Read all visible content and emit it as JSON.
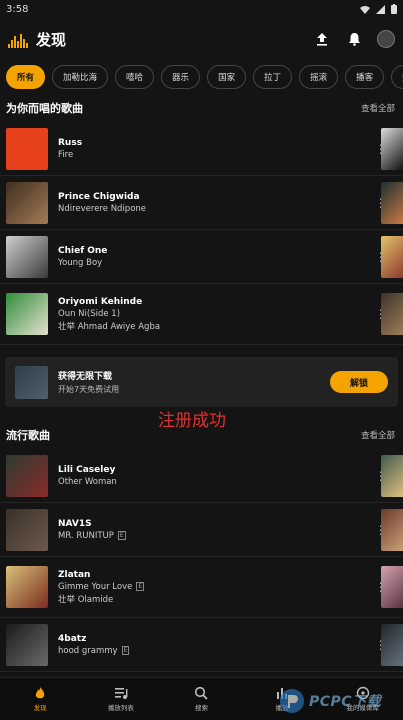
{
  "status": {
    "time": "3:58"
  },
  "header": {
    "title": "发现"
  },
  "chips": [
    "所有",
    "加勒比海",
    "嘻哈",
    "器乐",
    "国家",
    "拉丁",
    "摇滚",
    "播客",
    "旁遇"
  ],
  "section1": {
    "title": "为你而唱的歌曲",
    "see_all": "查看全部"
  },
  "songs1": [
    {
      "name": "Russ",
      "sub": "Fire",
      "sub2": "",
      "colors": [
        "#e6411c",
        "#e6411c"
      ],
      "peek": [
        "#ddd",
        "#111"
      ]
    },
    {
      "name": "Prince Chigwida",
      "sub": "Ndireverere Ndipone",
      "sub2": "",
      "colors": [
        "#3f2e22",
        "#a47b54"
      ],
      "peek": [
        "#1e3030",
        "#c87844"
      ]
    },
    {
      "name": "Chief One",
      "sub": "Young Boy",
      "sub2": "",
      "colors": [
        "#cfcfcf",
        "#3a3a3a"
      ],
      "peek": [
        "#e5c36a",
        "#8b3b2f"
      ]
    },
    {
      "name": "Oriyomi Kehinde",
      "sub": "Oun Ni(Side 1)",
      "sub2": "壮举 Ahmad Awiye Agba",
      "colors": [
        "#2f8e3b",
        "#e6e0d0"
      ],
      "peek": [
        "#3d3429",
        "#9c7c5a"
      ]
    }
  ],
  "promo": {
    "title": "获得无限下载",
    "sub": "开始7天免费试用",
    "button": "解锁"
  },
  "overlay_text": "注册成功",
  "section2": {
    "title": "流行歌曲",
    "see_all": "查看全部"
  },
  "songs2": [
    {
      "name": "Lili Caseley",
      "sub": "Other Woman",
      "sub2": "",
      "explicit": false,
      "colors": [
        "#2d3a2e",
        "#8b2d2d"
      ],
      "peek": [
        "#3c5a4c",
        "#e0c080"
      ]
    },
    {
      "name": "NAV1S",
      "sub": "MR. RUNITUP",
      "sub2": "",
      "explicit": true,
      "colors": [
        "#3a3028",
        "#6c5a4a"
      ],
      "peek": [
        "#6b3a2c",
        "#caa076"
      ]
    },
    {
      "name": "Zlatan",
      "sub": "Gimme Your Love",
      "sub2": "壮举 Olamide",
      "explicit": true,
      "colors": [
        "#d9c27a",
        "#7b2b1f"
      ],
      "peek": [
        "#d6a3b0",
        "#5a3444"
      ]
    },
    {
      "name": "4batz",
      "sub": "hood grammy",
      "sub2": "",
      "explicit": true,
      "colors": [
        "#1b1b1b",
        "#6a6a6a"
      ],
      "peek": [
        "#20282c",
        "#66707a"
      ]
    }
  ],
  "explicit_label": "E",
  "tabs": [
    {
      "label": "发现",
      "icon": "flame-icon",
      "active": true
    },
    {
      "label": "播放列表",
      "icon": "playlist-icon",
      "active": false
    },
    {
      "label": "搜索",
      "icon": "search-icon",
      "active": false
    },
    {
      "label": "播放",
      "icon": "equalizer-icon",
      "active": false
    },
    {
      "label": "我的媒体库",
      "icon": "library-icon",
      "active": false
    }
  ],
  "watermark": "PCPC下载",
  "accent": "#f5a300"
}
